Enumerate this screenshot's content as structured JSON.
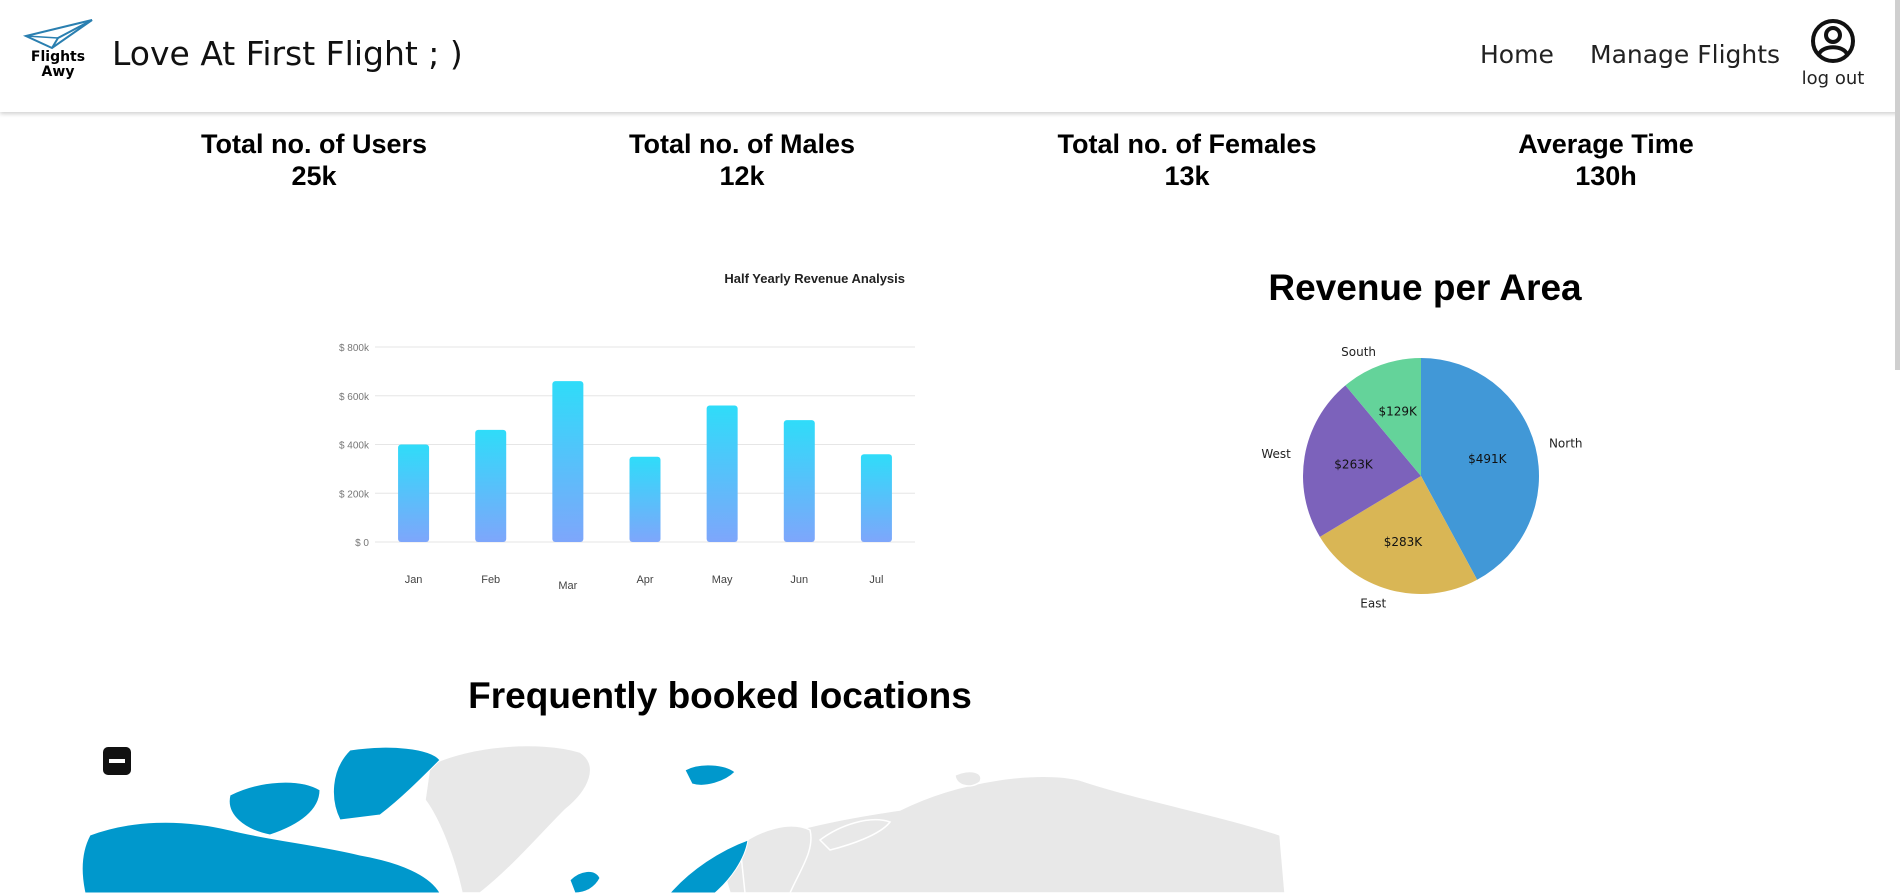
{
  "header": {
    "logo_text_line1": "Flights",
    "logo_text_line2": "Awy",
    "title": "Love At First Flight ; )",
    "nav": [
      {
        "label": "Home"
      },
      {
        "label": "Manage Flights"
      }
    ],
    "account": {
      "icon": "account-circle-icon",
      "label": "log out"
    }
  },
  "stats": [
    {
      "label": "Total no. of Users",
      "value": "25k"
    },
    {
      "label": "Total no. of Males",
      "value": "12k"
    },
    {
      "label": "Total no. of Females",
      "value": "13k"
    },
    {
      "label": "Average Time",
      "value": "130h"
    }
  ],
  "chart_data": [
    {
      "type": "bar",
      "title": "Half Yearly Revenue Analysis",
      "xlabel": "",
      "ylabel": "",
      "categories": [
        "Jan",
        "Feb",
        "Mar",
        "Apr",
        "May",
        "Jun",
        "Jul"
      ],
      "values": [
        400000,
        460000,
        660000,
        350000,
        560000,
        500000,
        360000
      ],
      "y_ticks": [
        "$ 0",
        "$ 200k",
        "$ 400k",
        "$ 600k",
        "$ 800k"
      ],
      "ylim": [
        0,
        800000
      ],
      "grid": true,
      "colors": {
        "top": "#2fdcf9",
        "bottom": "#7ea6fb"
      }
    },
    {
      "type": "pie",
      "title": "Revenue per Area",
      "labels": [
        "North",
        "East",
        "West",
        "South"
      ],
      "values": [
        491,
        283,
        263,
        129
      ],
      "value_labels": [
        "$491K",
        "$283K",
        "$263K",
        "$129K"
      ],
      "colors": [
        "#4198d7",
        "#d9b655",
        "#7c62bb",
        "#64d39a"
      ]
    }
  ],
  "map": {
    "title": "Frequently booked locations",
    "zoom_out_label": "zoom-out",
    "highlight_color": "#0098cc",
    "land_color": "#e8e8e8"
  }
}
